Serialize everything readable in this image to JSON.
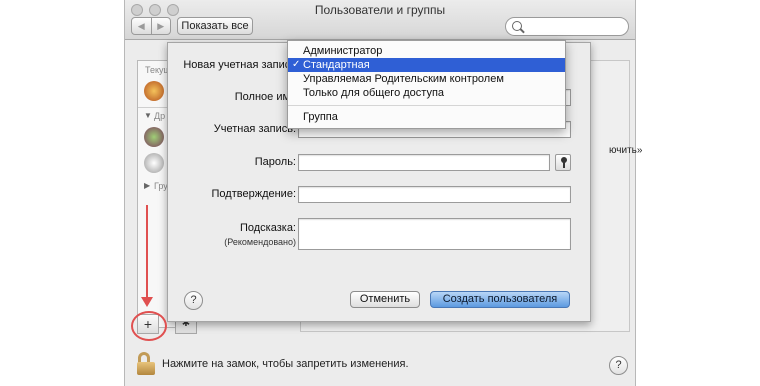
{
  "window": {
    "title": "Пользователи и группы",
    "show_all": "Показать все",
    "search_placeholder": ""
  },
  "sidebar": {
    "current_header": "Текущ",
    "other_header": "Др",
    "groups_label": "Груп"
  },
  "behind": {
    "right_text_fragment": "ючить»",
    "bottom_text": "Нажмите на замок, чтобы запретить изменения.",
    "help": "?"
  },
  "sheet": {
    "labels": {
      "new_account": "Новая учетная запись",
      "full_name": "Полное имя",
      "account_name": "Учетная запись:",
      "password": "Пароль:",
      "confirm": "Подтверждение:",
      "hint": "Подсказка:",
      "hint_sub": "(Рекомендовано)"
    },
    "fields": {
      "full_name": "",
      "account_name": "",
      "password": "",
      "confirm": "",
      "hint": ""
    },
    "help": "?",
    "cancel": "Отменить",
    "create": "Создать пользователя"
  },
  "menu": {
    "items": [
      "Администратор",
      "Стандартная",
      "Управляемая Родительским контролем",
      "Только для общего доступа",
      "Группа"
    ],
    "selected_index": 1,
    "checkmark": "✓"
  },
  "toolbar": {
    "add": "+",
    "settings": "✱"
  },
  "colors": {
    "selection": "#2f5fd5",
    "annotation": "#e05050",
    "primary_button": "#5d9ae0"
  }
}
